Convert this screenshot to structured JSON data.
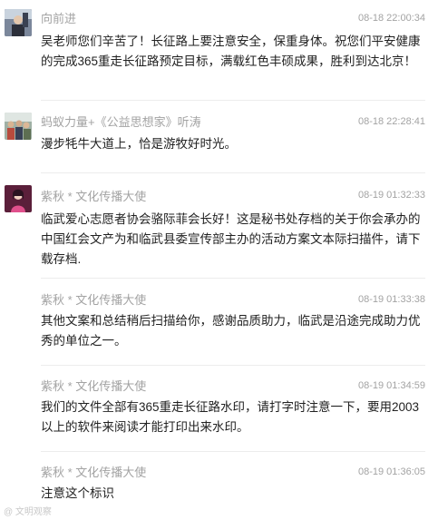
{
  "comments": [
    {
      "author": "向前进",
      "time": "08-18 22:00:34",
      "text": "吴老师您们辛苦了！长征路上要注意安全，保重身体。祝您们平安健康的完成365重走长征路预定目标，满载红色丰硕成果，胜利到达北京！",
      "avatar": "person-photo"
    },
    {
      "author": "蚂蚁力量+《公益思想家》听涛",
      "time": "08-18 22:28:41",
      "text": "漫步牦牛大道上，恰是游牧好时光。",
      "avatar": "group-photo"
    },
    {
      "author": "紫秋 * 文化传播大使",
      "time": "08-19 01:32:33",
      "text": "临武爱心志愿者协会骆际菲会长好！这是秘书处存档的关于你会承办的中国红会文产为和临武县委宣传部主办的活动方案文本际扫描件，请下载存档.",
      "avatar": "portrait-photo"
    },
    {
      "author": "紫秋 * 文化传播大使",
      "time": "08-19 01:33:38",
      "text": "其他文案和总结稍后扫描给你，感谢品质助力，临武是沿途完成助力优秀的单位之一。",
      "avatar": ""
    },
    {
      "author": "紫秋 * 文化传播大使",
      "time": "08-19 01:34:59",
      "text": "我们的文件全部有365重走长征路水印，请打字时注意一下，要用2003以上的软件来阅读才能打印出来水印。",
      "avatar": ""
    },
    {
      "author": "紫秋 * 文化传播大使",
      "time": "08-19 01:36:05",
      "text": "注意这个标识",
      "avatar": ""
    }
  ],
  "watermark": "@ 文明观察"
}
